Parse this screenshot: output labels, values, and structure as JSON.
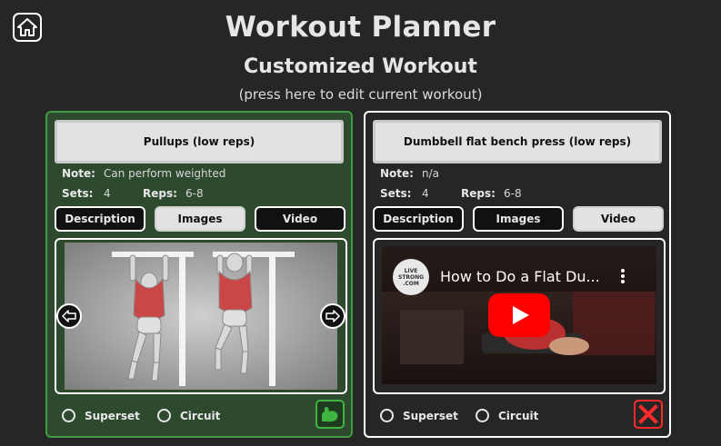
{
  "header": {
    "title": "Workout Planner",
    "subtitle": "Customized Workout",
    "edit_hint": "(press here to edit current workout)"
  },
  "colors": {
    "background": "#262626",
    "selected_card_bg": "#2d4a2e",
    "selected_card_border": "#3e9b3e",
    "delete_red": "#ff2a2a",
    "add_green": "#3fb43f"
  },
  "labels": {
    "note": "Note:",
    "sets": "Sets:",
    "reps": "Reps:",
    "tab_description": "Description",
    "tab_images": "Images",
    "tab_video": "Video",
    "superset": "Superset",
    "circuit": "Circuit"
  },
  "exercises": [
    {
      "name": "Pullups (low reps)",
      "note": "Can perform weighted",
      "sets": "4",
      "reps": "6-8",
      "active_tab": "Images",
      "selected": true,
      "superset_checked": false,
      "circuit_checked": false,
      "action_icon": "flexed-arm-icon"
    },
    {
      "name": "Dumbbell flat bench press (low reps)",
      "note": "n/a",
      "sets": "4",
      "reps": "6-8",
      "active_tab": "Video",
      "selected": false,
      "superset_checked": false,
      "circuit_checked": false,
      "video_title": "How to Do a Flat Du...",
      "channel_logo_text": "LIVE STRONG .COM",
      "action_icon": "delete-x-icon"
    }
  ]
}
